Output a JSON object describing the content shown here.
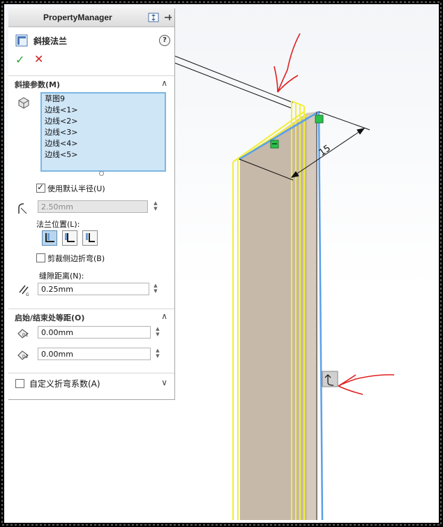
{
  "panel": {
    "title": "PropertyManager",
    "feature_name": "斜接法兰",
    "help": "?",
    "ok_symbol": "✓",
    "cancel_symbol": "✕"
  },
  "miter_params": {
    "title": "斜接参数(M)",
    "items": [
      "草图9",
      "边线<1>",
      "边线<2>",
      "边线<3>",
      "边线<4>",
      "边线<5>"
    ],
    "use_default_radius": {
      "label": "使用默认半径(U)",
      "checked": true
    },
    "radius": "2.50mm",
    "flange_position_label": "法兰位置(L):",
    "trim_bends": {
      "label": "剪裁侧边折弯(B)",
      "checked": false
    },
    "gap_label": "缝隙距离(N):",
    "gap_value": "0.25mm",
    "gap_icon_text": "G"
  },
  "offsets": {
    "title": "启始/结束处等距(O)",
    "d1_icon_text": "D1",
    "d1_value": "0.00mm",
    "d2_icon_text": "D2",
    "d2_value": "0.00mm"
  },
  "custom_bend": {
    "label": "自定义折弯系数(A)",
    "checked": false
  },
  "viewport": {
    "dimension_label": "15"
  }
}
